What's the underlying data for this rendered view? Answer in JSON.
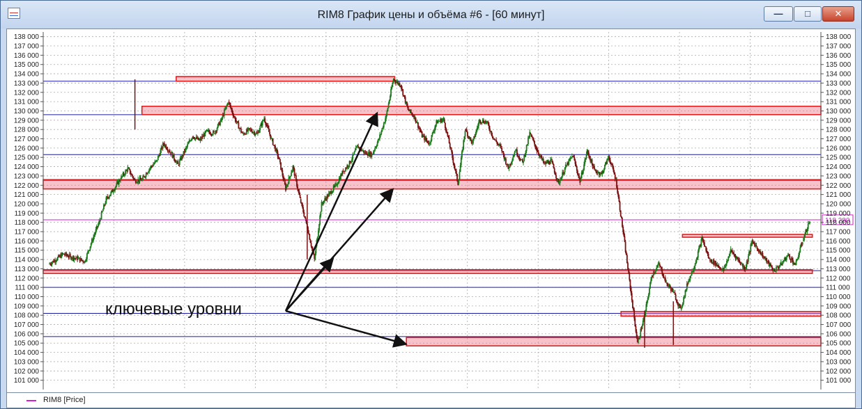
{
  "window": {
    "title": "RIM8 График цены и объёма #6 - [60 минут]",
    "minimize_glyph": "—",
    "maximize_glyph": "□",
    "close_glyph": "✕"
  },
  "legend": {
    "label": "RIM8 [Price]",
    "color": "#d41dd4"
  },
  "chart_data": {
    "type": "line",
    "series_style": "candlestick",
    "ylim": [
      100000,
      138500
    ],
    "yticks": [
      101000,
      102000,
      103000,
      104000,
      105000,
      106000,
      107000,
      108000,
      109000,
      110000,
      111000,
      112000,
      113000,
      114000,
      115000,
      116000,
      117000,
      118000,
      119000,
      120000,
      121000,
      122000,
      123000,
      124000,
      125000,
      126000,
      127000,
      128000,
      129000,
      130000,
      131000,
      132000,
      133000,
      134000,
      135000,
      136000,
      137000,
      138000
    ],
    "grid": true,
    "last_price": 118280,
    "last_price_label": "118 280",
    "colors": {
      "up": "#1a7a1a",
      "down": "#7a1010",
      "zone": "#e02020",
      "level": "#1a1aa0",
      "price_line": "#d41dd4"
    },
    "series": [
      {
        "values": [
          113500,
          114000,
          114600,
          114300,
          114100,
          113800,
          116000,
          118000,
          120500,
          121500,
          122700,
          123800,
          122500,
          122600,
          123800,
          124600,
          126500,
          125500,
          124200,
          125800,
          127300,
          126800,
          127800,
          127600,
          129000,
          131000,
          129000,
          127500,
          128000,
          127500,
          129200,
          127000,
          125000,
          121600,
          124000,
          120500,
          117500,
          114000,
          120000,
          121000,
          122000,
          123500,
          124500,
          126200,
          125500,
          125300,
          127000,
          129500,
          133400,
          132800,
          130200,
          129300,
          127300,
          126500,
          128800,
          129100,
          125800,
          122200,
          128000,
          126500,
          129000,
          128800,
          127000,
          126000,
          123800,
          125800,
          124400,
          127600,
          125800,
          124300,
          124600,
          122200,
          124000,
          125200,
          122400,
          125700,
          123600,
          123200,
          125100,
          122600,
          117000,
          111000,
          105000,
          108000,
          112300,
          113500,
          111500,
          110500,
          108600,
          111500,
          113500,
          116300,
          114000,
          113500,
          112800,
          115000,
          114000,
          113000,
          116000,
          114900,
          113800,
          112800,
          113500,
          114500,
          113400,
          116000,
          118200
        ]
      }
    ],
    "zones": [
      {
        "y1": 133200,
        "y2": 133700
      },
      {
        "y1": 129600,
        "y2": 130500
      },
      {
        "y1": 121600,
        "y2": 122600
      },
      {
        "y1": 112500,
        "y2": 112900
      },
      {
        "y1": 116400,
        "y2": 116700
      },
      {
        "y1": 107900,
        "y2": 108400
      },
      {
        "y1": 104700,
        "y2": 105600
      }
    ],
    "levels": [
      133200,
      129600,
      125300,
      122500,
      112800,
      111000,
      108200,
      105700
    ],
    "annotation": {
      "text": "ключевые уровни"
    }
  }
}
